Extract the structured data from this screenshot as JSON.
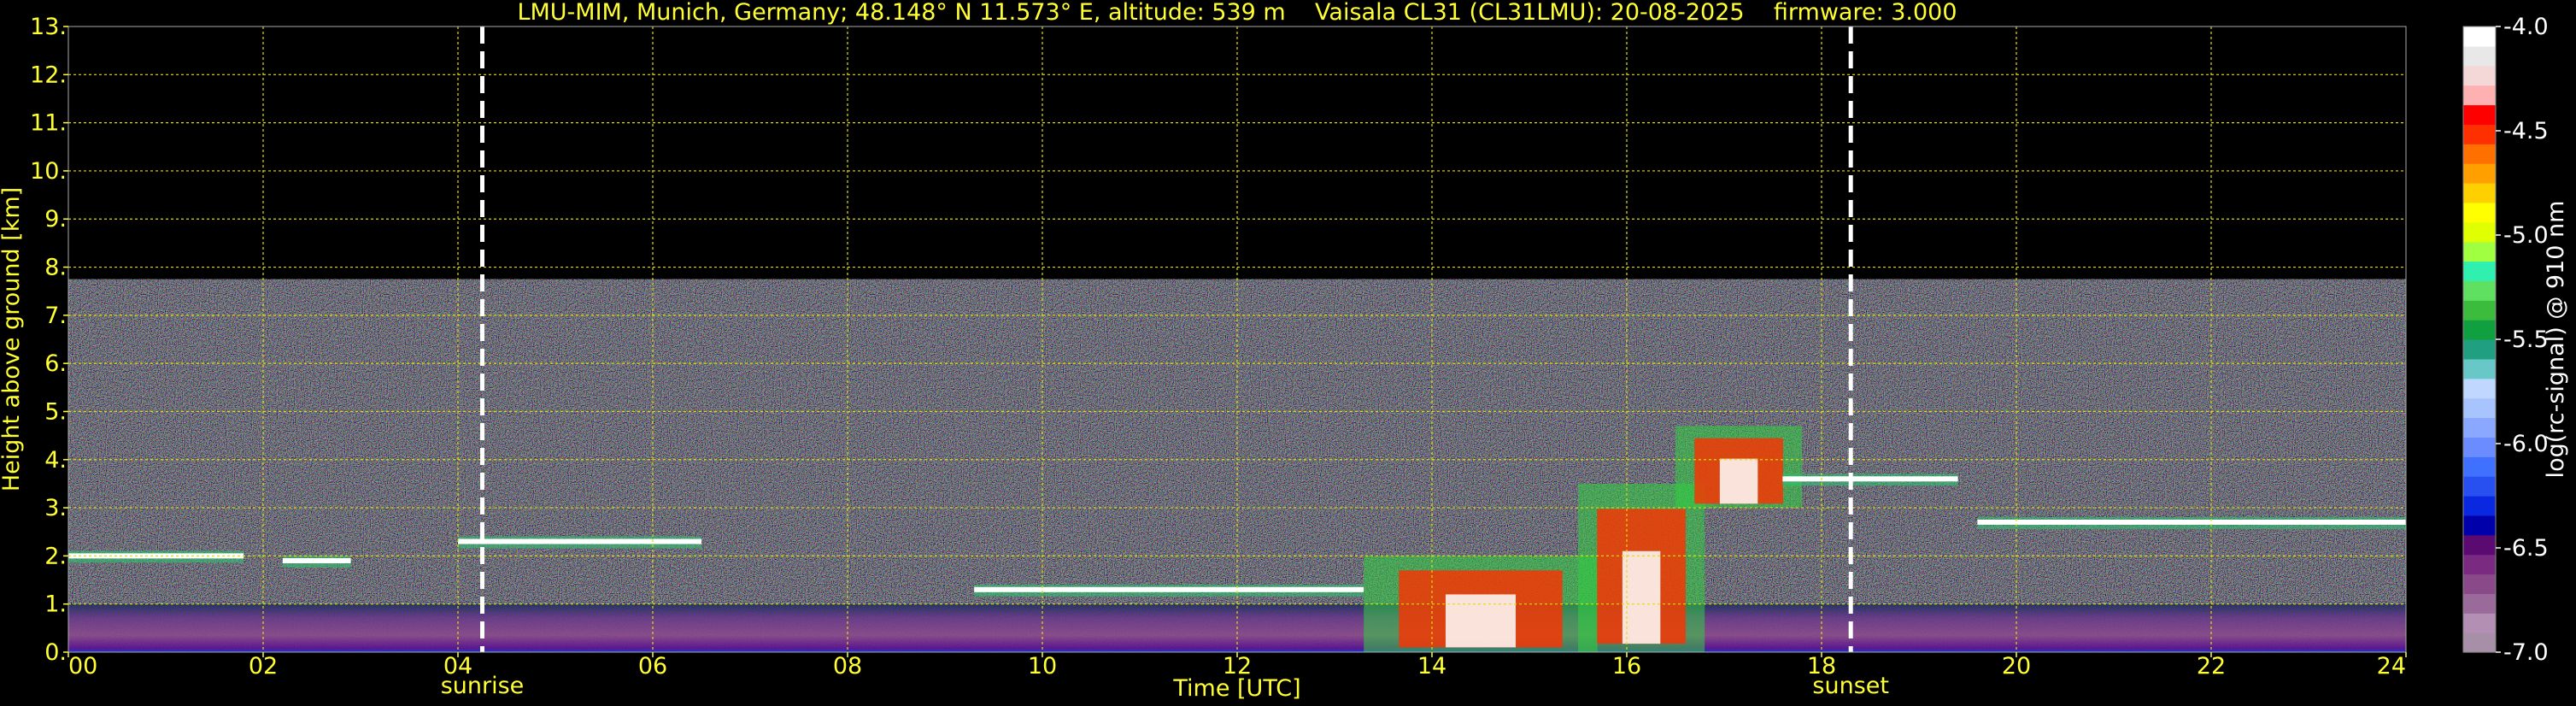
{
  "header": {
    "title": "LMU-MIM, Munich, Germany; 48.148° N 11.573° E, altitude: 539 m    Vaisala CL31 (CL31LMU): 20-08-2025    firmware: 3.000"
  },
  "chart_data": {
    "type": "heatmap",
    "title": "LMU-MIM, Munich, Germany; 48.148° N 11.573° E, altitude: 539 m    Vaisala CL31 (CL31LMU): 20-08-2025    firmware: 3.000",
    "xlabel": "Time [UTC]",
    "ylabel": "Height above ground [km]",
    "xlim": [
      0,
      24
    ],
    "ylim": [
      0,
      13
    ],
    "x_ticks": [
      0,
      2,
      4,
      6,
      8,
      10,
      12,
      14,
      16,
      18,
      20,
      22,
      24
    ],
    "x_tick_labels": [
      "00",
      "02",
      "04",
      "06",
      "08",
      "10",
      "12",
      "14",
      "16",
      "18",
      "20",
      "22",
      "24"
    ],
    "y_ticks": [
      0,
      1,
      2,
      3,
      4,
      5,
      6,
      7,
      8,
      9,
      10,
      11,
      12,
      13
    ],
    "y_tick_labels": [
      "0.",
      "1.",
      "2.",
      "3.",
      "4.",
      "5.",
      "6.",
      "7.",
      "8.",
      "9.",
      "10.",
      "11.",
      "12.",
      "13."
    ],
    "grid": true,
    "markers": [
      {
        "label": "sunrise",
        "time_utc": 4.25
      },
      {
        "label": "sunset",
        "time_utc": 18.3
      }
    ],
    "colorbar": {
      "label": "log(rc-signal) @ 910 nm",
      "range": [
        -7.0,
        -4.0
      ],
      "ticks": [
        -4.0,
        -4.5,
        -5.0,
        -5.5,
        -6.0,
        -6.5,
        -7.0
      ],
      "tick_labels": [
        "-4.0",
        "-4.5",
        "-5.0",
        "-5.5",
        "-6.0",
        "-6.5",
        "-7.0"
      ],
      "colors": [
        "#a88fa8",
        "#b48fb4",
        "#9a6a9a",
        "#8a4a8a",
        "#7a2a80",
        "#5a0a70",
        "#0000aa",
        "#0a28e0",
        "#2850f0",
        "#4070ff",
        "#6a8cff",
        "#8aa8ff",
        "#a8c4ff",
        "#c0d8ff",
        "#68c8c8",
        "#20a080",
        "#10a040",
        "#3cbc3c",
        "#60e060",
        "#30f0b0",
        "#a0ff40",
        "#e0ff00",
        "#ffff00",
        "#ffd000",
        "#ffa000",
        "#ff7000",
        "#ff3000",
        "#ff0000",
        "#ffb0b0",
        "#f4d8d8",
        "#e8e8e8",
        "#ffffff"
      ]
    },
    "features": [
      {
        "type": "nocturnal_layer",
        "time_start": 0.0,
        "time_end": 1.8,
        "height_km": 2.0
      },
      {
        "type": "nocturnal_layer",
        "time_start": 2.2,
        "time_end": 2.9,
        "height_km": 1.9
      },
      {
        "type": "nocturnal_layer",
        "time_start": 4.0,
        "time_end": 6.5,
        "height_km": 2.3
      },
      {
        "type": "boundary_layer_top",
        "time_start": 9.3,
        "time_end": 13.3,
        "height_km": 1.3
      },
      {
        "type": "convective_cloud",
        "time_start": 13.3,
        "time_end": 15.7,
        "base_km": 0.0,
        "top_km": 2.0
      },
      {
        "type": "convective_cloud",
        "time_start": 15.5,
        "time_end": 16.8,
        "base_km": 0.0,
        "top_km": 3.5
      },
      {
        "type": "cloud_layer",
        "time_start": 16.5,
        "time_end": 17.8,
        "base_km": 3.0,
        "top_km": 4.7
      },
      {
        "type": "cloud_layer",
        "time_start": 17.6,
        "time_end": 19.4,
        "height_km": 3.6
      },
      {
        "type": "cloud_layer",
        "time_start": 19.6,
        "time_end": 24.0,
        "height_km": 2.7
      }
    ]
  },
  "axes": {
    "xlabel": "Time [UTC]",
    "ylabel": "Height above ground [km]",
    "colorbar_label": "log(rc-signal) @ 910 nm"
  },
  "colors": {
    "axis_text": "#ffff33",
    "grid": "#e0e000",
    "background": "#000000",
    "marker_line": "#ffffff"
  }
}
